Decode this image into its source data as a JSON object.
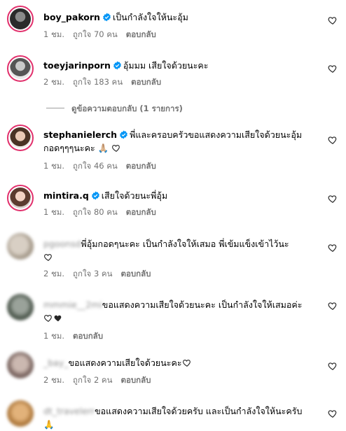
{
  "comments": [
    {
      "username": "boy_pakorn",
      "verified": true,
      "text": "เป็นกำลังใจให้นะอุ้ม",
      "time": "1 ชม.",
      "likes": "ถูกใจ 70 คน",
      "reply": "ตอบกลับ"
    },
    {
      "username": "toeyjarinporn",
      "verified": true,
      "text": "อุ้มมม เสียใจด้วยนะคะ",
      "time": "2 ชม.",
      "likes": "ถูกใจ 183 คน",
      "reply": "ตอบกลับ",
      "view_replies": "ดูข้อความตอบกลับ (1 รายการ)"
    },
    {
      "username": "stephanielerch",
      "verified": true,
      "text": "พี่และครอบครัวขอแสดงความเสียใจด้วยนะอุ้ม",
      "text2": "กอดๆๆๆนะคะ 🙏🏼",
      "time": "1 ชม.",
      "likes": "ถูกใจ 46 คน",
      "reply": "ตอบกลับ"
    },
    {
      "username": "mintira.q",
      "verified": true,
      "text": "เสียใจด้วยนะพี่อุ้ม",
      "time": "1 ชม.",
      "likes": "ถูกใจ 80 คน",
      "reply": "ตอบกลับ"
    },
    {
      "username": "pgoonsd",
      "verified": false,
      "text": "พี่อุ้มกอดๆนะคะ เป็นกำลังใจให้เสมอ พี่เข้มแข็งเข้าไว้นะ",
      "time": "2 ชม.",
      "likes": "ถูกใจ 3 คน",
      "reply": "ตอบกลับ"
    },
    {
      "username": "mmmie__2mi",
      "verified": false,
      "text": "ขอแสดงความเสียใจด้วยนะคะ เป็นกำลังใจให้เสมอค่ะ",
      "time": "1 ชม.",
      "reply": "ตอบกลับ"
    },
    {
      "username": "_bay_",
      "verified": false,
      "text": "ขอแสดงความเสียใจด้วยนะคะ",
      "time": "2 ชม.",
      "likes": "ถูกใจ 2 คน",
      "reply": "ตอบกลับ"
    },
    {
      "username": "dt_travelerr",
      "verified": false,
      "text": "ขอแสดงความเสียใจด้วยครับ และเป็นกำลังใจให้นะครับ",
      "text2": "🙏"
    }
  ],
  "colors": {
    "verified": "#0095f6",
    "meta": "#737373",
    "ring": "#e1306c"
  }
}
